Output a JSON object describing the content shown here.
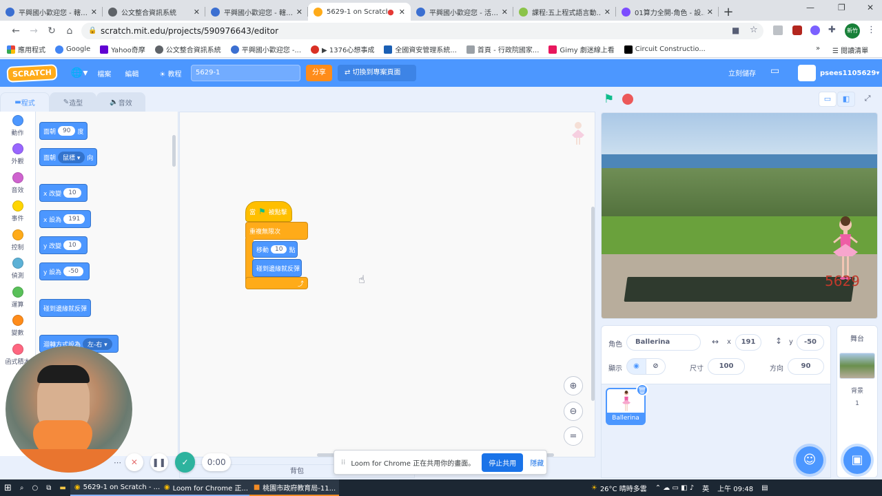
{
  "browser": {
    "tabs": [
      {
        "title": "平興國小歡迎您 - 轄…",
        "color": "#3b6fd1"
      },
      {
        "title": "公文整合資訊系統",
        "color": "#5f6368"
      },
      {
        "title": "平興國小歡迎您 - 轄…",
        "color": "#3b6fd1"
      },
      {
        "title": "5629-1 on Scratch",
        "color": "#ffab19",
        "active": true
      },
      {
        "title": "平興國小歡迎您 - 活…",
        "color": "#3b6fd1"
      },
      {
        "title": "課程:五上程式語言動…",
        "color": "#8bc34a"
      },
      {
        "title": "01算力全開-角色 - 設…",
        "color": "#7c4dff"
      }
    ],
    "new_tab": "+",
    "url": "scratch.mit.edu/projects/590976643/editor",
    "bookmarks": [
      "應用程式",
      "Google",
      "Yahoo奇摩",
      "公文整合資訊系統",
      "平興國小歡迎您 -...",
      "▶ 1376心想事成",
      "全國資安管理系統...",
      "首頁 - 行政院國家...",
      "Gimy 劇迷線上看",
      "Circuit Constructio..."
    ],
    "reading_list": "閱讀清單",
    "profile": "新竹"
  },
  "menubar": {
    "logo": "SCRATCH",
    "file": "檔案",
    "edit": "編輯",
    "tutorials": "教程",
    "project_title": "5629-1",
    "share": "分享",
    "see_project": "切換到專案頁面",
    "save_now": "立刻儲存",
    "username": "psees1105629"
  },
  "editor_tabs": {
    "code": "程式",
    "costumes": "造型",
    "sounds": "音效"
  },
  "categories": [
    {
      "label": "動作",
      "color": "#4c97ff"
    },
    {
      "label": "外觀",
      "color": "#9966ff"
    },
    {
      "label": "音效",
      "color": "#cf63cf"
    },
    {
      "label": "事件",
      "color": "#ffd500"
    },
    {
      "label": "控制",
      "color": "#ffab19"
    },
    {
      "label": "偵測",
      "color": "#5cb1d6"
    },
    {
      "label": "運算",
      "color": "#59c059"
    },
    {
      "label": "變數",
      "color": "#ff8c1a"
    },
    {
      "label": "函式積木",
      "color": "#ff6680"
    }
  ],
  "palette": {
    "turn_to_degrees_a": "面朝",
    "turn_to_degrees_val": "90",
    "turn_to_degrees_b": "度",
    "point_towards_a": "面朝",
    "point_towards_val": "鼠標 ▾",
    "point_towards_b": "向",
    "change_x_a": "x 改變",
    "change_x_val": "10",
    "set_x_a": "x 設為",
    "set_x_val": "191",
    "change_y_a": "y 改變",
    "change_y_val": "10",
    "set_y_a": "y 設為",
    "set_y_val": "-50",
    "bounce": "碰到邊緣就反彈",
    "rotation_a": "迴轉方式設為",
    "rotation_val": "左-右 ▾"
  },
  "script": {
    "when_flag_a": "當",
    "when_flag_b": "被點擊",
    "forever": "重複無限次",
    "move_a": "移動",
    "move_val": "10",
    "move_b": "點",
    "bounce": "碰到邊緣就反彈"
  },
  "backpack": "背包",
  "sprite": {
    "label_sprite": "角色",
    "name": "Ballerina",
    "label_x": "x",
    "x": "191",
    "label_y": "y",
    "y": "-50",
    "label_show": "顯示",
    "label_size": "尺寸",
    "size": "100",
    "label_direction": "方向",
    "direction": "90",
    "thumb_name": "Ballerina",
    "stage_text": "5629"
  },
  "stage_panel": {
    "title": "舞台",
    "backdrops_label": "背景",
    "backdrops_count": "1"
  },
  "loom": {
    "timer": "0:00",
    "notice": "Loom for Chrome 正在共用你的畫面。",
    "stop_share": "停止共用",
    "hide": "隱藏"
  },
  "taskbar": {
    "apps": [
      "5629-1 on Scratch - ...",
      "Loom for Chrome 正...",
      "桃園市政府教育局-11..."
    ],
    "weather": "26°C 晴時多雲",
    "ime": "英",
    "time": "上午 09:48"
  }
}
